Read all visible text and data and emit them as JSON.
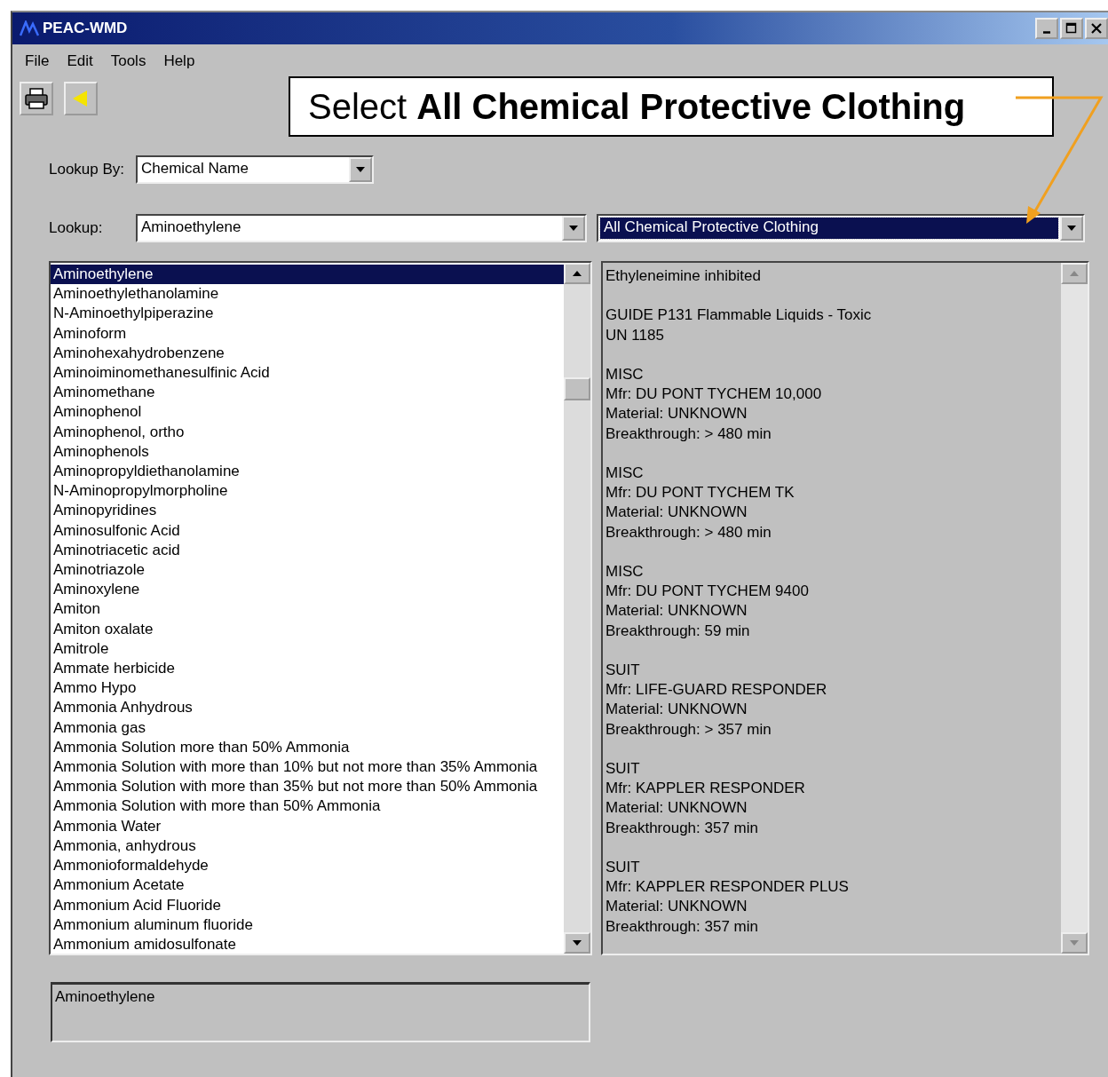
{
  "window": {
    "title": "PEAC-WMD"
  },
  "menu": [
    {
      "label": "File"
    },
    {
      "label": "Edit"
    },
    {
      "label": "Tools"
    },
    {
      "label": "Help"
    }
  ],
  "callout": {
    "text": "Select **All Chemical Protective Clothing**"
  },
  "lookup_by": {
    "label": "Lookup By:",
    "value": "Chemical Name"
  },
  "lookup": {
    "label": "Lookup:",
    "value": "Aminoethylene"
  },
  "category": {
    "value": "All Chemical Protective Clothing"
  },
  "chemical_list": {
    "items": [
      {
        "name": "Aminoethylene",
        "selected": true
      },
      {
        "name": "Aminoethylethanolamine",
        "selected": false
      },
      {
        "name": "N-Aminoethylpiperazine",
        "selected": false
      },
      {
        "name": "Aminoform",
        "selected": false
      },
      {
        "name": "Aminohexahydrobenzene",
        "selected": false
      },
      {
        "name": "Aminoiminomethanesulfinic Acid",
        "selected": false
      },
      {
        "name": "Aminomethane",
        "selected": false
      },
      {
        "name": "Aminophenol",
        "selected": false
      },
      {
        "name": "Aminophenol, ortho",
        "selected": false
      },
      {
        "name": "Aminophenols",
        "selected": false
      },
      {
        "name": "Aminopropyldiethanolamine",
        "selected": false
      },
      {
        "name": "N-Aminopropylmorpholine",
        "selected": false
      },
      {
        "name": "Aminopyridines",
        "selected": false
      },
      {
        "name": "Aminosulfonic Acid",
        "selected": false
      },
      {
        "name": "Aminotriacetic acid",
        "selected": false
      },
      {
        "name": "Aminotriazole",
        "selected": false
      },
      {
        "name": "Aminoxylene",
        "selected": false
      },
      {
        "name": "Amiton",
        "selected": false
      },
      {
        "name": "Amiton oxalate",
        "selected": false
      },
      {
        "name": "Amitrole",
        "selected": false
      },
      {
        "name": "Ammate herbicide",
        "selected": false
      },
      {
        "name": "Ammo Hypo",
        "selected": false
      },
      {
        "name": "Ammonia Anhydrous",
        "selected": false
      },
      {
        "name": "Ammonia gas",
        "selected": false
      },
      {
        "name": "Ammonia Solution more than 50% Ammonia",
        "selected": false
      },
      {
        "name": "Ammonia Solution with more than 10% but not more than 35% Ammonia",
        "selected": false
      },
      {
        "name": "Ammonia Solution with more than 35% but not more than 50% Ammonia",
        "selected": false
      },
      {
        "name": "Ammonia Solution with more than 50% Ammonia",
        "selected": false
      },
      {
        "name": "Ammonia Water",
        "selected": false
      },
      {
        "name": "Ammonia, anhydrous",
        "selected": false
      },
      {
        "name": "Ammonioformaldehyde",
        "selected": false
      },
      {
        "name": "Ammonium Acetate",
        "selected": false
      },
      {
        "name": "Ammonium Acid Fluoride",
        "selected": false
      },
      {
        "name": "Ammonium aluminum fluoride",
        "selected": false
      },
      {
        "name": "Ammonium amidosulfonate",
        "selected": false
      }
    ]
  },
  "details": [
    {
      "lines": [
        "Ethyleneimine inhibited"
      ]
    },
    {
      "lines": [
        "GUIDE P131 Flammable Liquids - Toxic",
        "UN 1185"
      ]
    },
    {
      "lines": [
        "MISC",
        "Mfr: DU PONT TYCHEM 10,000",
        "Material: UNKNOWN",
        "Breakthrough: > 480 min"
      ]
    },
    {
      "lines": [
        "MISC",
        "Mfr: DU PONT TYCHEM TK",
        "Material: UNKNOWN",
        "Breakthrough: > 480 min"
      ]
    },
    {
      "lines": [
        "MISC",
        "Mfr: DU PONT TYCHEM 9400",
        "Material: UNKNOWN",
        "Breakthrough: 59 min"
      ]
    },
    {
      "lines": [
        "SUIT",
        "Mfr: LIFE-GUARD RESPONDER",
        "Material: UNKNOWN",
        "Breakthrough: > 357 min"
      ]
    },
    {
      "lines": [
        "SUIT",
        "Mfr: KAPPLER RESPONDER",
        "Material: UNKNOWN",
        "Breakthrough: 357 min"
      ]
    },
    {
      "lines": [
        "SUIT",
        "Mfr: KAPPLER RESPONDER PLUS",
        "Material: UNKNOWN",
        "Breakthrough: 357 min"
      ]
    }
  ],
  "selected_name": {
    "value": "Aminoethylene"
  }
}
